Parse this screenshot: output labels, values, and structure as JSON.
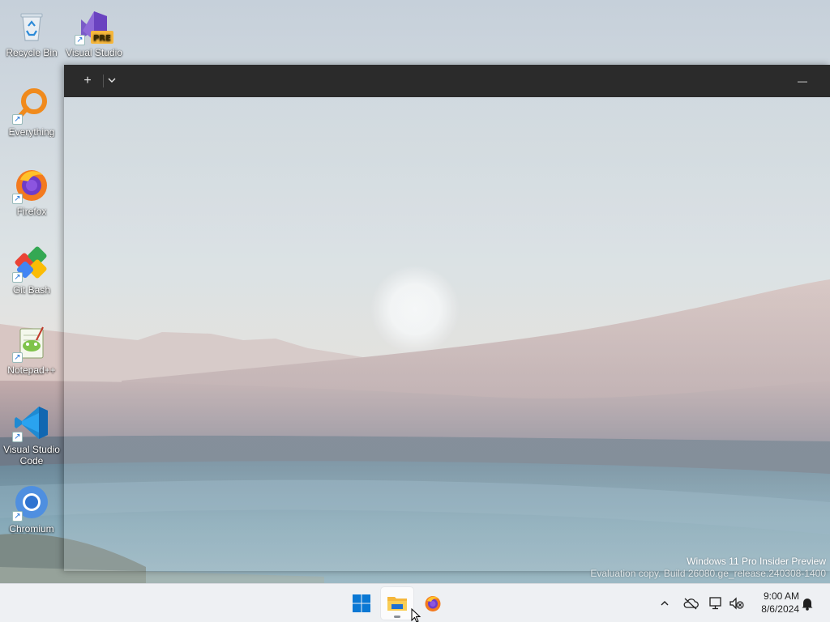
{
  "desktop": {
    "icons": [
      {
        "label": "Recycle Bin",
        "icon": "recycle-bin-icon"
      },
      {
        "label": "Visual Studio",
        "icon": "visual-studio-preview-icon",
        "badge": "PRE"
      },
      {
        "label": "Everything",
        "icon": "everything-search-icon"
      },
      {
        "label": "Firefox",
        "icon": "firefox-icon"
      },
      {
        "label": "Git Bash",
        "icon": "git-bash-icon"
      },
      {
        "label": "Notepad++",
        "icon": "notepad-plus-plus-icon"
      },
      {
        "label_line1": "Visual Studio",
        "label_line2": "Code",
        "icon": "vscode-icon"
      },
      {
        "label": "Chromium",
        "icon": "chromium-icon"
      }
    ]
  },
  "window": {
    "new_tab_label": "+",
    "dropdown_label": "⌄",
    "minimize_label": "—"
  },
  "watermark": {
    "line1": "Windows 11 Pro Insider Preview",
    "line2": "Evaluation copy. Build 26080.ge_release.240308-1400"
  },
  "taskbar": {
    "apps": [
      "start-icon",
      "file-explorer-icon",
      "firefox-icon"
    ],
    "tray": [
      "chevron-up-icon",
      "onedrive-offline-icon",
      "network-icon",
      "volume-muted-icon",
      "notification-bell-icon"
    ],
    "time": "9:00 AM",
    "date": "8/6/2024"
  },
  "colors": {
    "titlebar": "#2b2b2b",
    "taskbar": "#eef0f3",
    "windows_blue": "#0a78d4"
  }
}
